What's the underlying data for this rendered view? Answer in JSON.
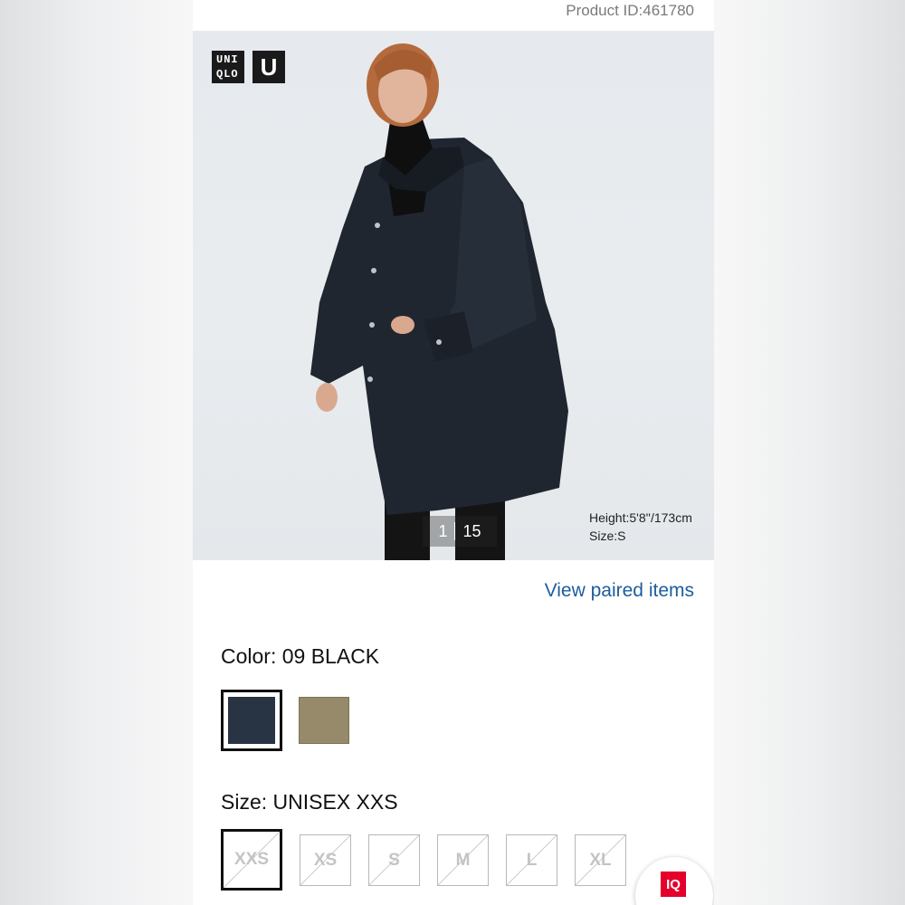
{
  "product": {
    "id_text": "Product ID:461780"
  },
  "hero": {
    "logo_text": "UNIQLO",
    "logo_line1": "UNI",
    "logo_line2": "QLO",
    "logo_u": "U",
    "counter_current": "1",
    "counter_total": "15",
    "model_height": "Height:5'8''/173cm",
    "model_size": "Size:S"
  },
  "links": {
    "view_paired": "View paired items"
  },
  "color": {
    "label": "Color: 09 BLACK",
    "swatches": [
      {
        "name": "09 BLACK",
        "hex": "#283443",
        "selected": true
      },
      {
        "name": "Olive",
        "hex": "#978a6b",
        "selected": false
      }
    ]
  },
  "size": {
    "label": "Size: UNISEX XXS",
    "options": [
      {
        "label": "XXS",
        "selected": true,
        "unavailable": true
      },
      {
        "label": "XS",
        "selected": false,
        "unavailable": true
      },
      {
        "label": "S",
        "selected": false,
        "unavailable": true
      },
      {
        "label": "M",
        "selected": false,
        "unavailable": true
      },
      {
        "label": "L",
        "selected": false,
        "unavailable": true
      },
      {
        "label": "XL",
        "selected": false,
        "unavailable": true
      }
    ]
  },
  "fab": {
    "label": "IQ",
    "icon": "iq-chat-icon",
    "color": "#e4002b"
  }
}
